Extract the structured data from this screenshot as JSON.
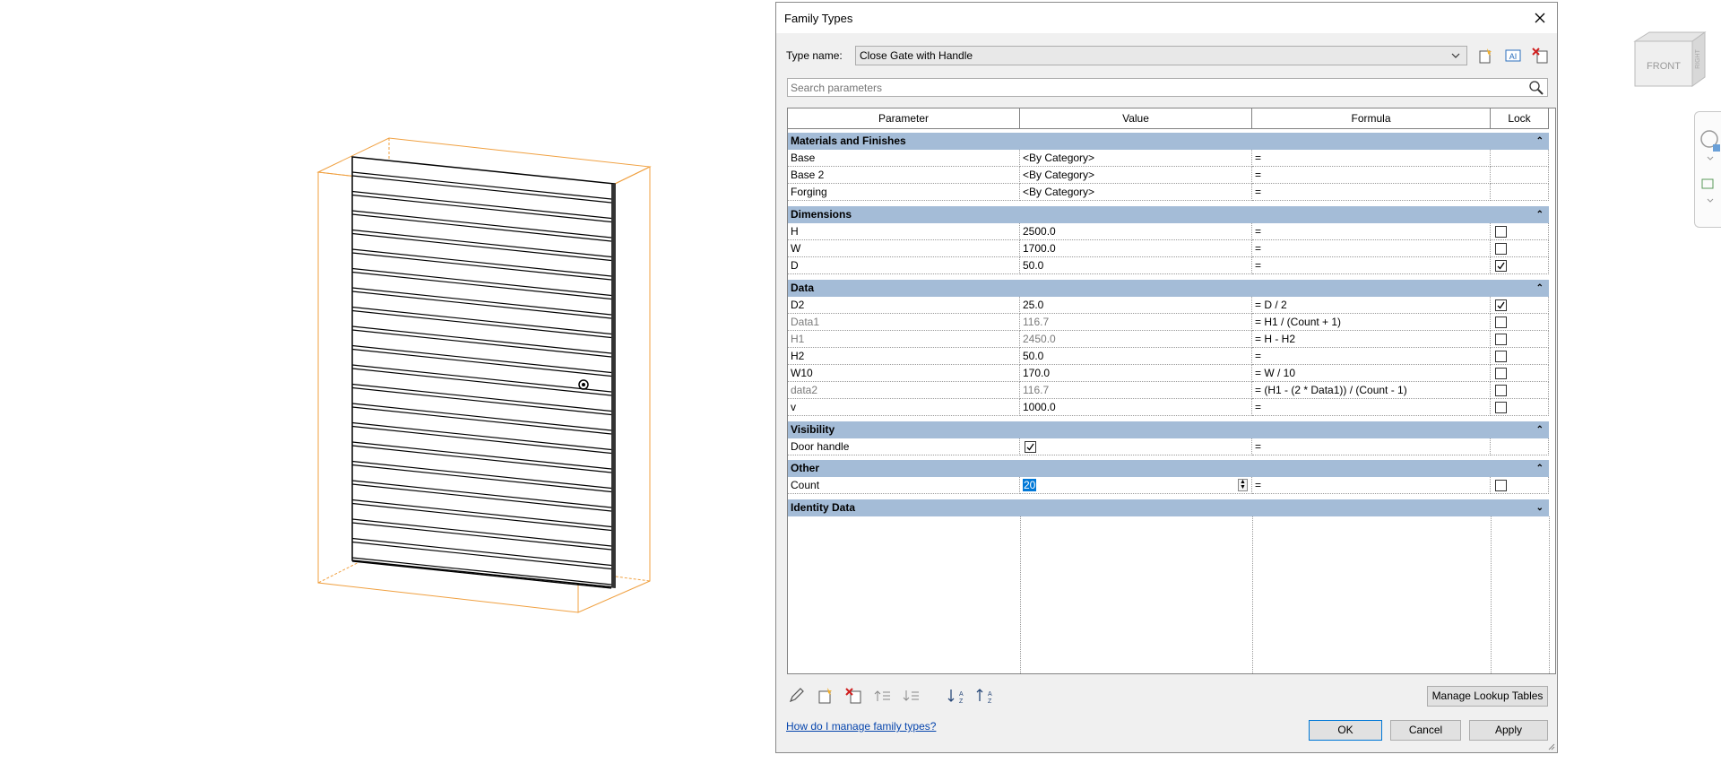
{
  "viewcube": {
    "front": "FRONT",
    "side": "RIGHT"
  },
  "dialog": {
    "title": "Family Types",
    "type_name_label": "Type name:",
    "type_name_value": "Close Gate with Handle",
    "search_placeholder": "Search parameters",
    "columns": [
      "Parameter",
      "Value",
      "Formula",
      "Lock"
    ],
    "groups": [
      {
        "name": "Materials and Finishes",
        "rows": [
          {
            "param": "Base",
            "value": "<By Category>",
            "formula": "="
          },
          {
            "param": "Base 2",
            "value": "<By Category>",
            "formula": "="
          },
          {
            "param": "Forging",
            "value": "<By Category>",
            "formula": "="
          }
        ]
      },
      {
        "name": "Dimensions",
        "rows": [
          {
            "param": "H",
            "value": "2500.0",
            "formula": "=",
            "lock": false
          },
          {
            "param": "W",
            "value": "1700.0",
            "formula": "=",
            "lock": false
          },
          {
            "param": "D",
            "value": "50.0",
            "formula": "=",
            "lock": true
          }
        ]
      },
      {
        "name": "Data",
        "rows": [
          {
            "param": "D2",
            "value": "25.0",
            "formula": "= D / 2",
            "lock": true
          },
          {
            "param": "Data1",
            "value": "116.7",
            "formula": "= H1 / (Count + 1)",
            "lock": false
          },
          {
            "param": "H1",
            "value": "2450.0",
            "formula": "= H - H2",
            "lock": false
          },
          {
            "param": "H2",
            "value": "50.0",
            "formula": "=",
            "lock": false
          },
          {
            "param": "W10",
            "value": "170.0",
            "formula": "= W / 10",
            "lock": false
          },
          {
            "param": "data2",
            "value": "116.7",
            "formula": "= (H1 - (2 * Data1)) / (Count - 1)",
            "lock": false
          },
          {
            "param": "v",
            "value": "1000.0",
            "formula": "=",
            "lock": false
          }
        ]
      },
      {
        "name": "Visibility",
        "rows": [
          {
            "param": "Door handle",
            "value_checked": true,
            "formula": "="
          }
        ]
      },
      {
        "name": "Other",
        "rows": [
          {
            "param": "Count",
            "value": "20",
            "formula": "=",
            "lock": false
          }
        ]
      },
      {
        "name": "Identity Data"
      }
    ],
    "manage_lookup_label": "Manage Lookup Tables",
    "help_link": "How do I manage family types?",
    "ok_label": "OK",
    "cancel_label": "Cancel",
    "apply_label": "Apply"
  }
}
